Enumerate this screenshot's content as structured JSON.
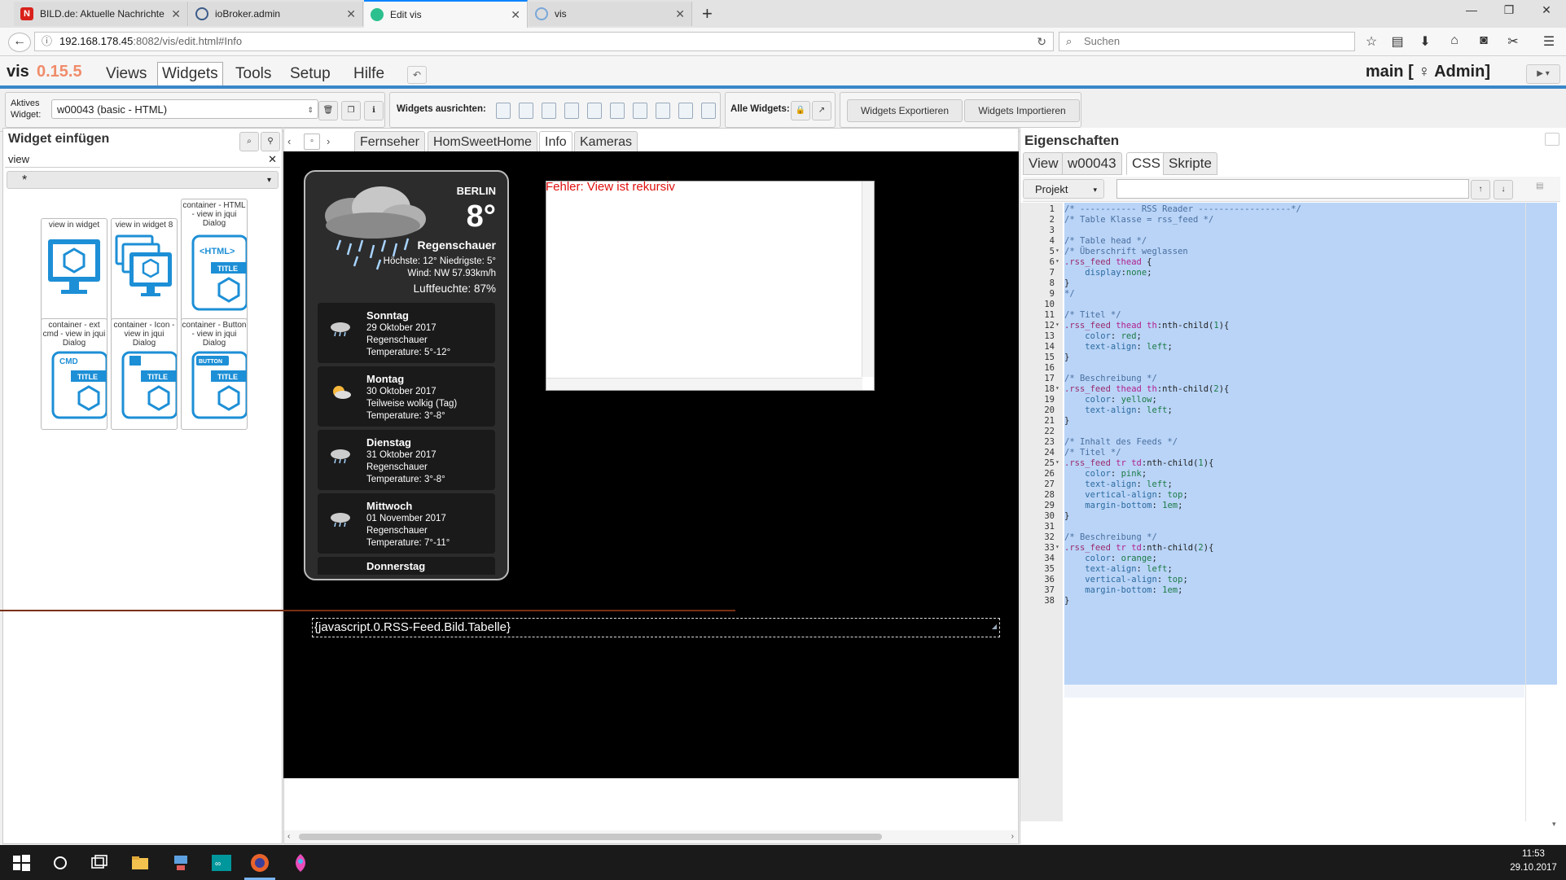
{
  "browser": {
    "tabs": [
      {
        "title": "BILD.de: Aktuelle Nachrichte",
        "favicon_color": "#d8211a"
      },
      {
        "title": "ioBroker.admin",
        "favicon_color": "#3b5b8a"
      },
      {
        "title": "Edit vis",
        "favicon_color": "#2cc08f"
      },
      {
        "title": "vis",
        "favicon_color": "#7aa7d9"
      }
    ],
    "url_host": "192.168.178.45",
    "url_rest": ":8082/vis/edit.html#Info",
    "search_placeholder": "Suchen"
  },
  "app": {
    "name": "vis",
    "version": "0.15.5",
    "menu": [
      "Views",
      "Widgets",
      "Tools",
      "Setup",
      "Hilfe"
    ],
    "active_menu": "Widgets",
    "user_info": "main [ ♀ Admin]"
  },
  "toolbar": {
    "active_widget_label": "Aktives Widget:",
    "active_widget_value": "w00043 (basic - HTML)",
    "align_label": "Widgets ausrichten:",
    "all_widgets_label": "Alle Widgets:",
    "export_label": "Widgets Exportieren",
    "import_label": "Widgets Importieren"
  },
  "left": {
    "title": "Widget einfügen",
    "filter_value": "view",
    "category_value": "*",
    "widgets": [
      {
        "label": "view in widget"
      },
      {
        "label": "view in widget 8"
      },
      {
        "label": "container - HTML - view in jqui Dialog"
      },
      {
        "label": "container - ext cmd - view in jqui Dialog"
      },
      {
        "label": "container - Icon - view in jqui Dialog"
      },
      {
        "label": "container - Button - view in jqui Dialog"
      }
    ]
  },
  "center": {
    "views": [
      "Fernseher",
      "HomSweetHome",
      "Info",
      "Kameras"
    ],
    "active_view": "Info",
    "error_text": "Fehler: View ist rekursiv",
    "binding_text": "{javascript.0.RSS-Feed.Bild.Tabelle}"
  },
  "weather": {
    "city": "BERLIN",
    "temp": "8°",
    "condition": "Regenschauer",
    "hilo": "Höchste: 12° Niedrigste: 5°",
    "wind": "Wind: NW 57.93km/h",
    "humidity": "Luftfeuchte: 87%",
    "forecast": [
      {
        "day": "Sonntag",
        "date": "29 Oktober 2017",
        "desc": "Regenschauer",
        "temp": "Temperature: 5°-12°"
      },
      {
        "day": "Montag",
        "date": "30 Oktober 2017",
        "desc": "Teilweise wolkig (Tag)",
        "temp": "Temperature: 3°-8°"
      },
      {
        "day": "Dienstag",
        "date": "31 Oktober 2017",
        "desc": "Regenschauer",
        "temp": "Temperature: 3°-8°"
      },
      {
        "day": "Mittwoch",
        "date": "01 November 2017",
        "desc": "Regenschauer",
        "temp": "Temperature: 7°-11°"
      },
      {
        "day": "Donnerstag"
      }
    ]
  },
  "right": {
    "title": "Eigenschaften",
    "tabs": [
      "View",
      "w00043",
      "CSS",
      "Skripte"
    ],
    "active_tab": "CSS",
    "scope_value": "Projekt",
    "code_lines": [
      "/* ----------- RSS Reader ------------------*/",
      "/* Table Klasse = rss_feed */",
      "",
      "/* Table head */",
      "/* Überschrift weglassen",
      ".rss_feed thead {",
      "    display:none;",
      "}",
      "*/",
      "",
      "/* Titel */",
      ".rss_feed thead th:nth-child(1){",
      "    color: red;",
      "    text-align: left;",
      "}",
      "",
      "/* Beschreibung */",
      ".rss_feed thead th:nth-child(2){",
      "    color: yellow;",
      "    text-align: left;",
      "}",
      "",
      "/* Inhalt des Feeds */",
      "/* Titel */",
      ".rss_feed tr td:nth-child(1){",
      "    color: pink;",
      "    text-align: left;",
      "    vertical-align: top;",
      "    margin-bottom: 1em;",
      "}",
      "",
      "/* Beschreibung */",
      ".rss_feed tr td:nth-child(2){",
      "    color: orange;",
      "    text-align: left;",
      "    vertical-align: top;",
      "    margin-bottom: 1em;",
      "}"
    ],
    "fold_lines": [
      5,
      6,
      12,
      18,
      25,
      33
    ]
  },
  "taskbar": {
    "time": "11:53",
    "date": "29.10.2017"
  },
  "colors": {
    "accent": "#3a87c8",
    "version": "#f08c6a",
    "error": "#e01010",
    "selection": "#b9d4f7"
  }
}
